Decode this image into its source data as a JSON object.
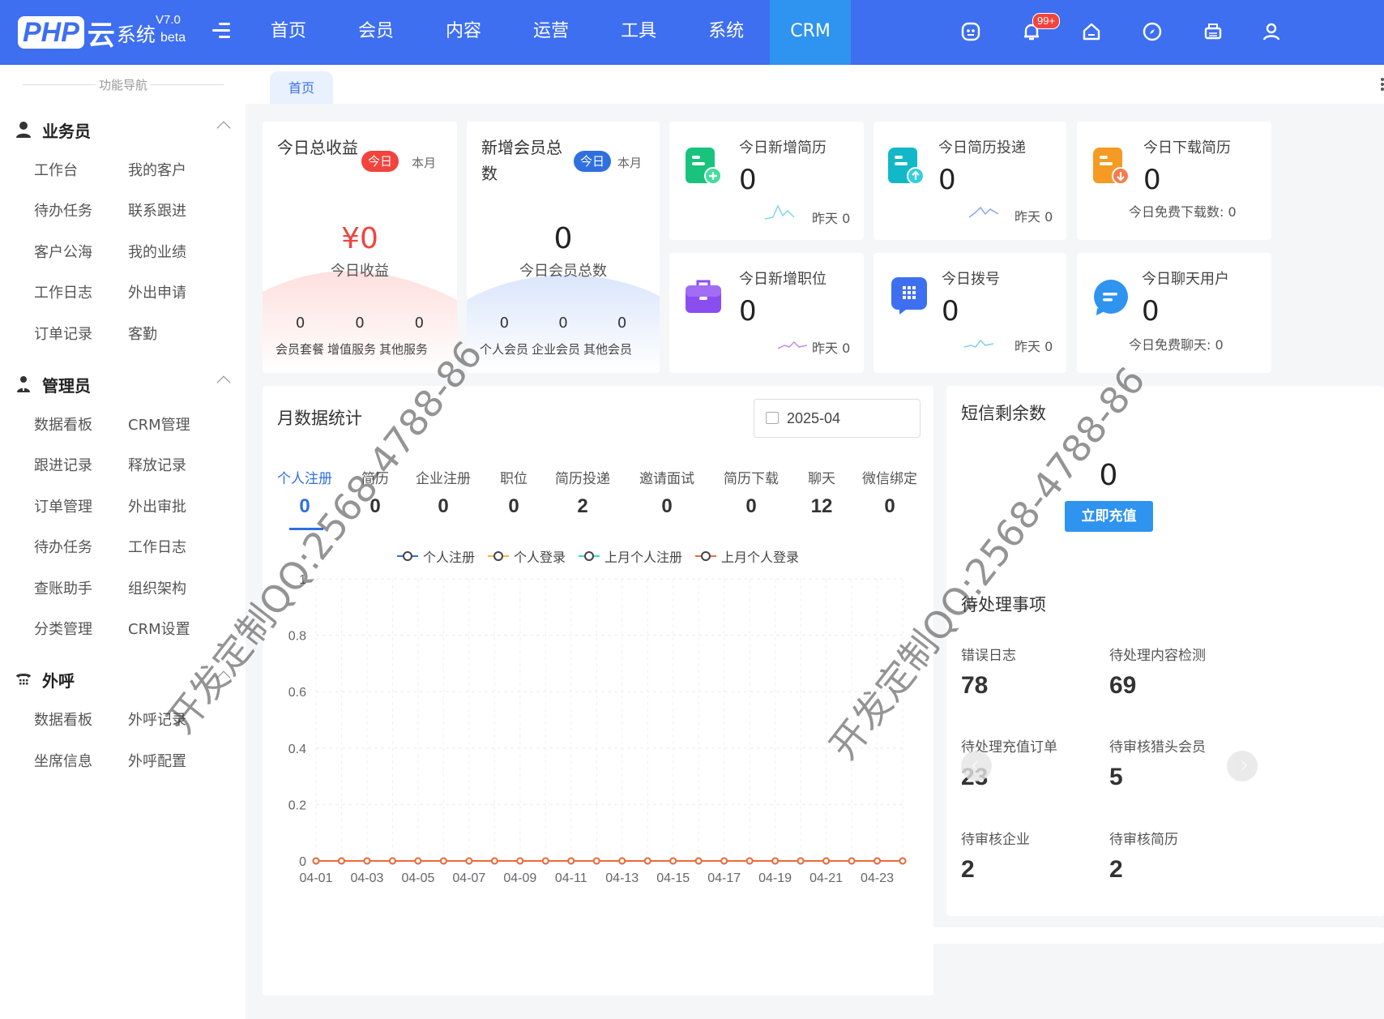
{
  "brand": {
    "php": "PHP",
    "yun": "云",
    "sys": "系统",
    "version": "V7.0",
    "beta": "beta"
  },
  "nav": [
    "首页",
    "会员",
    "内容",
    "运营",
    "工具",
    "系统",
    "CRM"
  ],
  "nav_active": "CRM",
  "notification_badge": "99+",
  "sidebar": {
    "title": "功能导航",
    "groups": [
      {
        "title": "业务员",
        "icon": "user-icon",
        "items": [
          "工作台",
          "我的客户",
          "待办任务",
          "联系跟进",
          "客户公海",
          "我的业绩",
          "工作日志",
          "外出申请",
          "订单记录",
          "客勤"
        ]
      },
      {
        "title": "管理员",
        "icon": "admin-users-icon",
        "items": [
          "数据看板",
          "CRM管理",
          "跟进记录",
          "释放记录",
          "订单管理",
          "外出审批",
          "待办任务",
          "工作日志",
          "查账助手",
          "组织架构",
          "分类管理",
          "CRM设置"
        ]
      },
      {
        "title": "外呼",
        "icon": "phone-icon",
        "items": [
          "数据看板",
          "外呼记录",
          "坐席信息",
          "外呼配置"
        ]
      }
    ]
  },
  "tabs": [
    "首页"
  ],
  "revenue": {
    "title": "今日总收益",
    "today": "今日",
    "month": "本月",
    "value": "¥0",
    "label": "今日收益",
    "nums": [
      "0",
      "0",
      "0"
    ],
    "labels": [
      "会员套餐",
      "增值服务",
      "其他服务"
    ]
  },
  "members": {
    "title": "新增会员总数",
    "today": "今日",
    "month": "本月",
    "value": "0",
    "label": "今日会员总数",
    "nums": [
      "0",
      "0",
      "0"
    ],
    "labels": [
      "个人会员",
      "企业会员",
      "其他会员"
    ]
  },
  "stats": [
    {
      "title": "今日新增简历",
      "value": "0",
      "foot": "昨天 0",
      "icon": "resume-add-icon",
      "color": "#19c37d"
    },
    {
      "title": "今日简历投递",
      "value": "0",
      "foot": "昨天 0",
      "icon": "resume-upload-icon",
      "color": "#12b8c8"
    },
    {
      "title": "今日下载简历",
      "value": "0",
      "foot": "今日免费下载数:  0",
      "icon": "resume-download-icon",
      "color": "#f59a23"
    },
    {
      "title": "今日新增职位",
      "value": "0",
      "foot": "昨天 0",
      "icon": "briefcase-icon",
      "color": "#8a4df0"
    },
    {
      "title": "今日拨号",
      "value": "0",
      "foot": "昨天 0",
      "icon": "dialpad-icon",
      "color": "#3e6ff0"
    },
    {
      "title": "今日聊天用户",
      "value": "0",
      "foot": "今日免费聊天:  0",
      "icon": "chat-icon",
      "color": "#2f93f0"
    }
  ],
  "monthly": {
    "title": "月数据统计",
    "date": "2025-04",
    "tabs": [
      {
        "label": "个人注册",
        "value": "0"
      },
      {
        "label": "简历",
        "value": "0"
      },
      {
        "label": "企业注册",
        "value": "0"
      },
      {
        "label": "职位",
        "value": "0"
      },
      {
        "label": "简历投递",
        "value": "2"
      },
      {
        "label": "邀请面试",
        "value": "0"
      },
      {
        "label": "简历下载",
        "value": "0"
      },
      {
        "label": "聊天",
        "value": "12"
      },
      {
        "label": "微信绑定",
        "value": "0"
      }
    ]
  },
  "chart_data": {
    "type": "line",
    "x": [
      "04-01",
      "04-02",
      "04-03",
      "04-04",
      "04-05",
      "04-06",
      "04-07",
      "04-08",
      "04-09",
      "04-10",
      "04-11",
      "04-12",
      "04-13",
      "04-14",
      "04-15",
      "04-16",
      "04-17",
      "04-18",
      "04-19",
      "04-20",
      "04-21",
      "04-22",
      "04-23",
      "04-24"
    ],
    "x_tick_labels": [
      "04-01",
      "04-03",
      "04-05",
      "04-07",
      "04-09",
      "04-11",
      "04-13",
      "04-15",
      "04-17",
      "04-19",
      "04-21",
      "04-23"
    ],
    "y_ticks": [
      "0",
      "0.2",
      "0.4",
      "0.6",
      "0.8",
      "1"
    ],
    "ylim": [
      0,
      1
    ],
    "series": [
      {
        "name": "个人注册",
        "color": "#2f6fe0",
        "values": [
          0,
          0,
          0,
          0,
          0,
          0,
          0,
          0,
          0,
          0,
          0,
          0,
          0,
          0,
          0,
          0,
          0,
          0,
          0,
          0,
          0,
          0,
          0,
          0
        ]
      },
      {
        "name": "个人登录",
        "color": "#f5b73b",
        "values": [
          0,
          0,
          0,
          0,
          0,
          0,
          0,
          0,
          0,
          0,
          0,
          0,
          0,
          0,
          0,
          0,
          0,
          0,
          0,
          0,
          0,
          0,
          0,
          0
        ]
      },
      {
        "name": "上月个人注册",
        "color": "#2ee0c8",
        "values": [
          0,
          0,
          0,
          0,
          0,
          0,
          0,
          0,
          0,
          0,
          0,
          0,
          0,
          0,
          0,
          0,
          0,
          0,
          0,
          0,
          0,
          0,
          0,
          0
        ]
      },
      {
        "name": "上月个人登录",
        "color": "#ee6a3a",
        "values": [
          0,
          0,
          0,
          0,
          0,
          0,
          0,
          0,
          0,
          0,
          0,
          0,
          0,
          0,
          0,
          0,
          0,
          0,
          0,
          0,
          0,
          0,
          0,
          0
        ]
      }
    ],
    "grid": true,
    "legend": "top"
  },
  "sms": {
    "title": "短信剩余数",
    "value": "0",
    "button": "立即充值"
  },
  "todo": {
    "title": "待处理事项",
    "items": [
      {
        "label": "错误日志",
        "value": "78"
      },
      {
        "label": "待处理内容检测",
        "value": "69"
      },
      {
        "label": "待处理充值订单",
        "value": "23"
      },
      {
        "label": "待审核猎头会员",
        "value": "5"
      },
      {
        "label": "待审核企业",
        "value": "2"
      },
      {
        "label": "待审核简历",
        "value": "2"
      }
    ]
  },
  "watermark": "开发定制QQ:2568-4788-86"
}
